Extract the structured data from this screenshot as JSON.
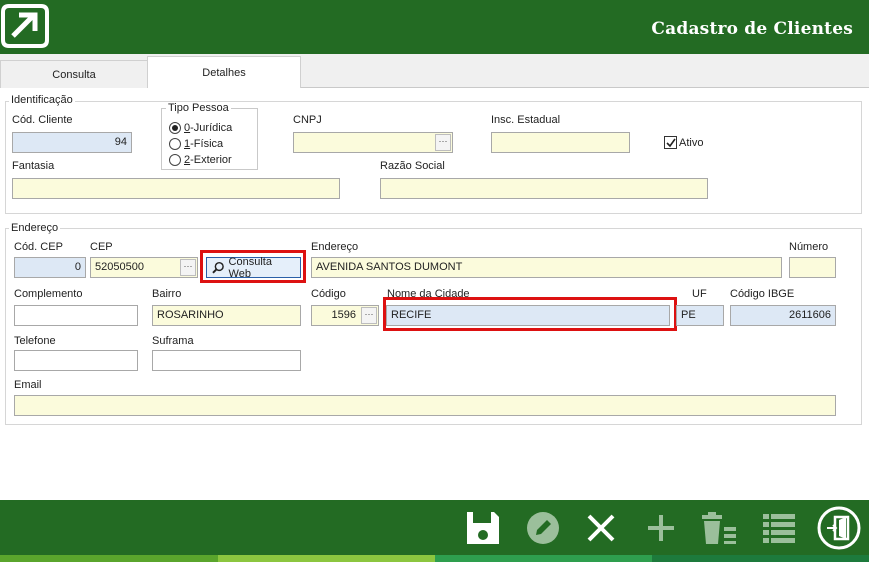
{
  "app": {
    "title": "Cadastro de Clientes"
  },
  "tabs": [
    {
      "label": "Consulta"
    },
    {
      "label": "Detalhes"
    }
  ],
  "identificacao": {
    "legend": "Identificação",
    "cod_cliente_label": "Cód. Cliente",
    "cod_cliente_value": "94",
    "tipo_pessoa_legend": "Tipo Pessoa",
    "tipo_pessoa_options": [
      {
        "key": "0",
        "rest": "-Jurídica",
        "checked": true
      },
      {
        "key": "1",
        "rest": "-Física",
        "checked": false
      },
      {
        "key": "2",
        "rest": "-Exterior",
        "checked": false
      }
    ],
    "cnpj_label": "CNPJ",
    "cnpj_value": "",
    "insc_estadual_label": "Insc. Estadual",
    "insc_estadual_value": "",
    "ativo_label": "Ativo",
    "ativo_checked": true,
    "fantasia_label": "Fantasia",
    "fantasia_value": "",
    "razao_social_label": "Razão Social",
    "razao_social_value": ""
  },
  "endereco": {
    "legend": "Endereço",
    "cod_cep_label": "Cód. CEP",
    "cod_cep_value": "0",
    "cep_label": "CEP",
    "cep_value": "52050500",
    "consulta_web_label": "Consulta Web",
    "endereco_label": "Endereço",
    "endereco_value": "AVENIDA SANTOS DUMONT",
    "numero_label": "Número",
    "numero_value": "",
    "complemento_label": "Complemento",
    "complemento_value": "",
    "bairro_label": "Bairro",
    "bairro_value": "ROSARINHO",
    "codigo_label": "Código",
    "codigo_value": "1596",
    "nome_cidade_label": "Nome da Cidade",
    "nome_cidade_value": "RECIFE",
    "uf_label": "UF",
    "uf_value": "PE",
    "codigo_ibge_label": "Código IBGE",
    "codigo_ibge_value": "2611606",
    "telefone_label": "Telefone",
    "telefone_value": "",
    "suframa_label": "Suframa",
    "suframa_value": "",
    "email_label": "Email",
    "email_value": ""
  },
  "ellipsis": "···",
  "toolbar": {
    "icons": [
      "save-icon",
      "edit-icon",
      "close-icon",
      "add-icon",
      "delete-list-icon",
      "list-icon",
      "exit-icon"
    ]
  },
  "colors": {
    "brand_green": "#236b23",
    "input_yellow": "#fbfbdc",
    "input_blue": "#dde8f5",
    "highlight_red": "#dd1111",
    "stripe": [
      "#5aa52c",
      "#8cc63f",
      "#2e9e4e",
      "#1d7a3c"
    ]
  }
}
